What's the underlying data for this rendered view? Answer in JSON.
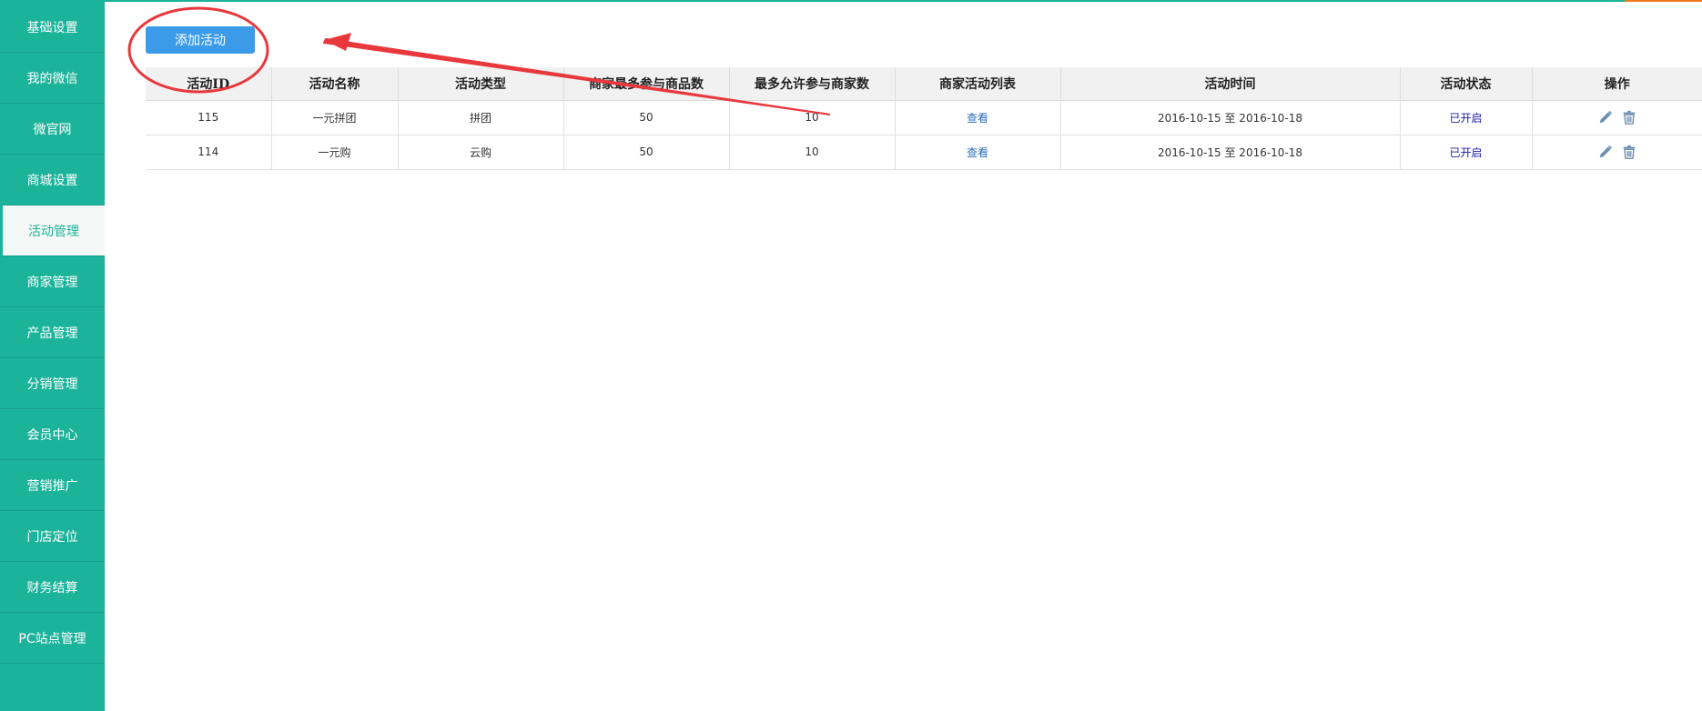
{
  "sidebar": {
    "items": [
      {
        "label": "基础设置"
      },
      {
        "label": "我的微信"
      },
      {
        "label": "微官网"
      },
      {
        "label": "商城设置"
      },
      {
        "label": "活动管理",
        "active": true
      },
      {
        "label": "商家管理"
      },
      {
        "label": "产品管理"
      },
      {
        "label": "分销管理"
      },
      {
        "label": "会员中心"
      },
      {
        "label": "营销推广"
      },
      {
        "label": "门店定位"
      },
      {
        "label": "财务结算"
      },
      {
        "label": "PC站点管理"
      }
    ]
  },
  "toolbar": {
    "add_label": "添加活动"
  },
  "table": {
    "headers": [
      "活动ID",
      "活动名称",
      "活动类型",
      "商家最多参与商品数",
      "最多允许参与商家数",
      "商家活动列表",
      "活动时间",
      "活动状态",
      "操作"
    ],
    "rows": [
      {
        "id": "115",
        "name": "一元拼团",
        "type": "拼团",
        "max_products": "50",
        "max_merchants": "10",
        "list_link": "查看",
        "time": "2016-10-15 至 2016-10-18",
        "status": "已开启"
      },
      {
        "id": "114",
        "name": "一元购",
        "type": "云购",
        "max_products": "50",
        "max_merchants": "10",
        "list_link": "查看",
        "time": "2016-10-15 至 2016-10-18",
        "status": "已开启"
      }
    ]
  },
  "colors": {
    "sidebar_bg": "#1cb39b",
    "button_bg": "#3c9be8",
    "annotation": "#e8383d",
    "link": "#2a6ebd",
    "status": "#1a1aa6"
  },
  "icons": {
    "edit": "pencil-icon",
    "delete": "trash-icon"
  }
}
